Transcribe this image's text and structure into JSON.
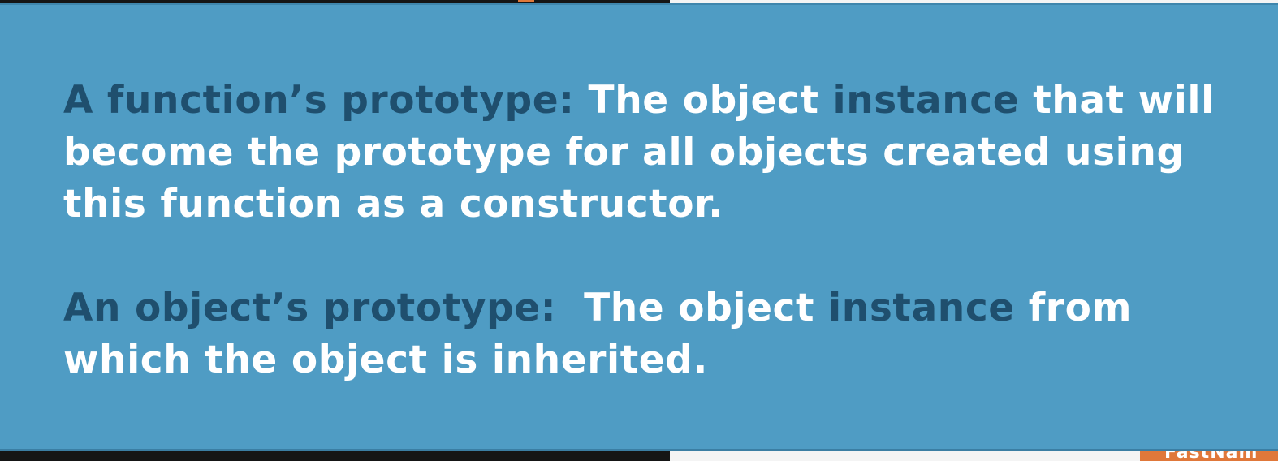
{
  "slide": {
    "para1": {
      "term": "A function’s prototype:",
      "text1": " The object ",
      "highlight": "instance",
      "text2": " that will become the prototype for all objects created using this function as a constructor."
    },
    "para2": {
      "term": "An object’s prototype:",
      "text1": "  The object ",
      "highlight": "instance",
      "text2": " from which the object is inherited."
    }
  },
  "background": {
    "corner_label": "FastNam"
  },
  "colors": {
    "slide_background": "#4f9cc4",
    "term_text": "#1f4f6e",
    "body_text": "#ffffff",
    "accent": "#e0783a"
  }
}
